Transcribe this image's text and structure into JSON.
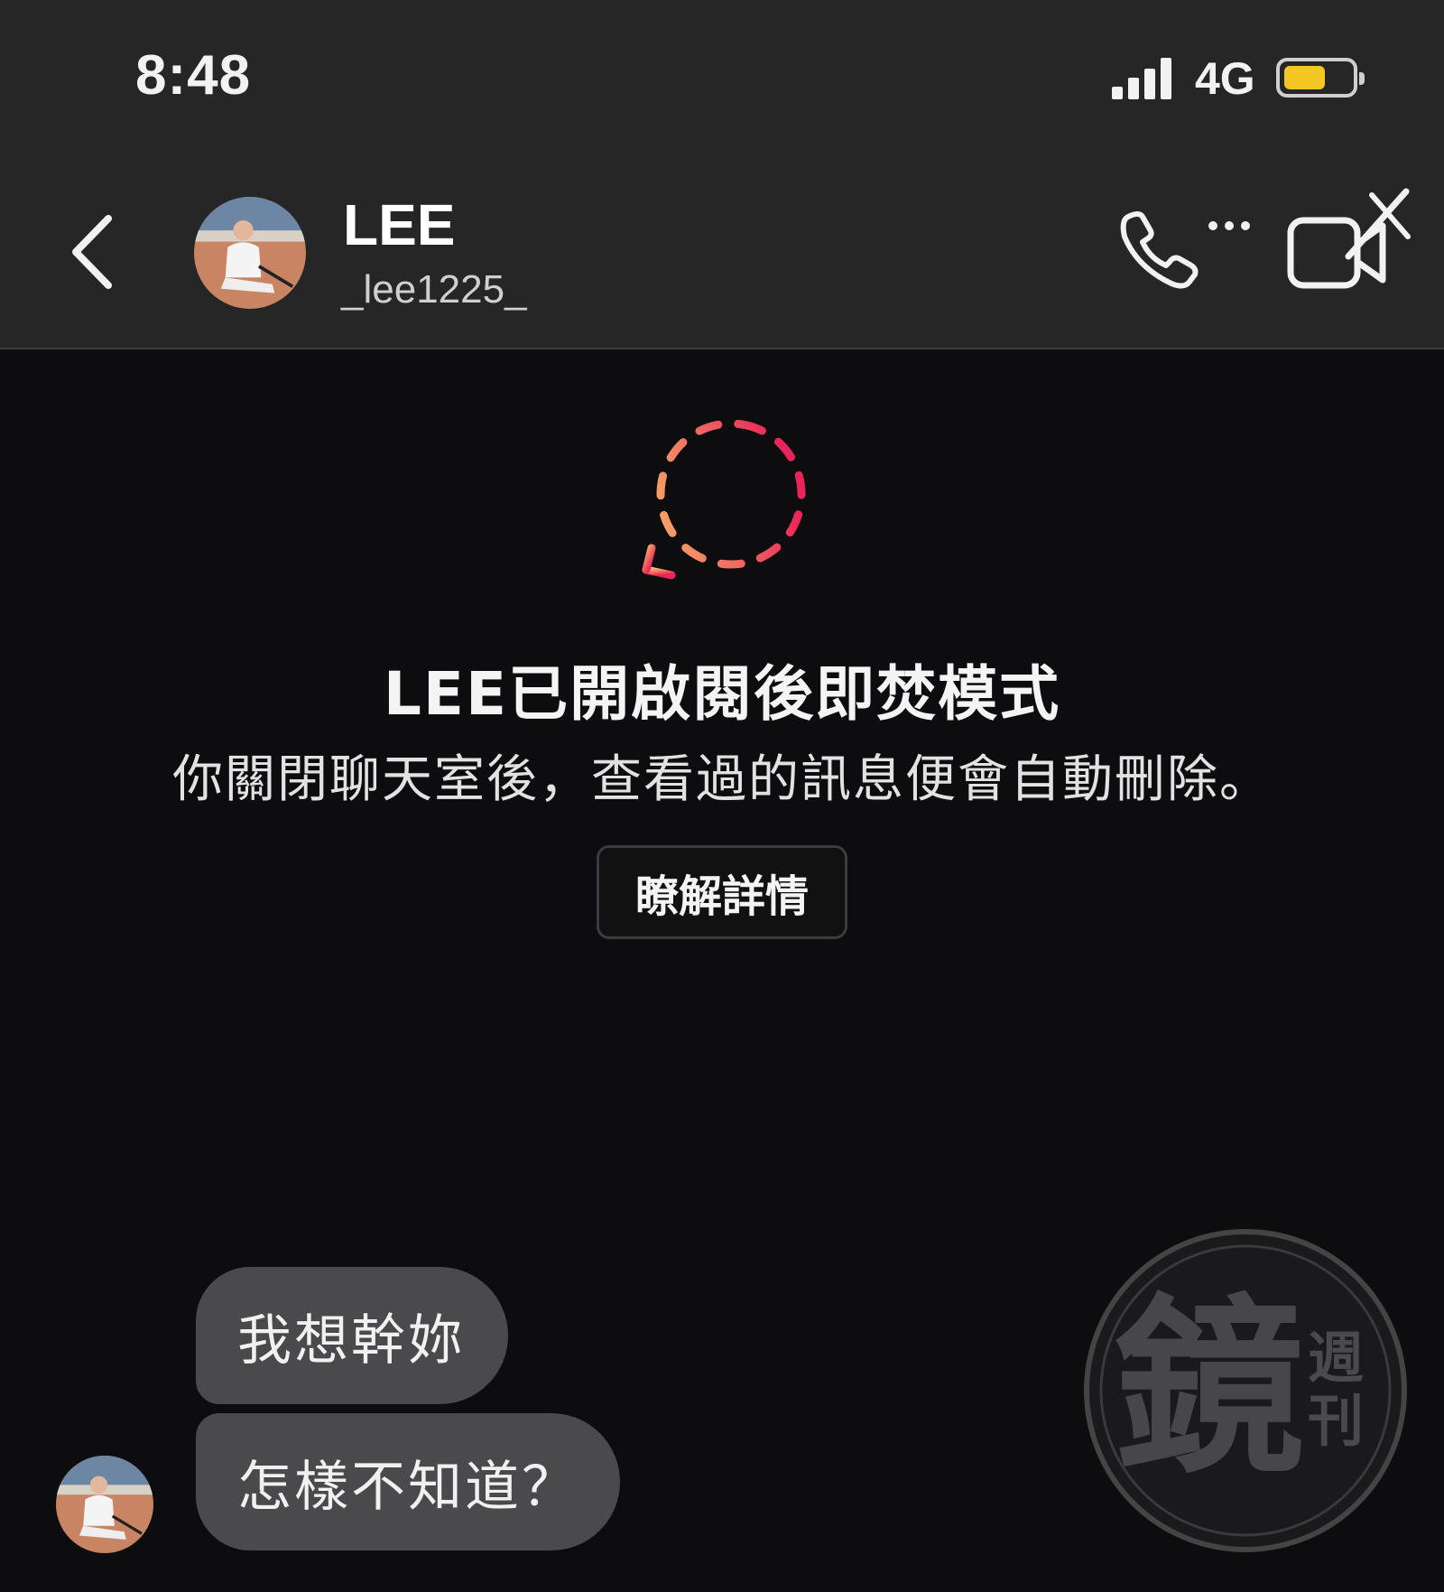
{
  "status_bar": {
    "time": "8:48",
    "network": "4G",
    "battery_level": 0.62,
    "icons": [
      "signal-icon",
      "battery-icon"
    ]
  },
  "header": {
    "contact_name": "LEE",
    "contact_handle": "_lee1225_",
    "icons": [
      "back-chevron-icon",
      "phone-icon",
      "video-camera-off-icon"
    ]
  },
  "vanish_mode": {
    "icon": "vanish-mode-dashed-bubble-icon",
    "title": "LEE已開啟閱後即焚模式",
    "description": "你關閉聊天室後，查看過的訊息便會自動刪除。",
    "learn_more_label": "瞭解詳情"
  },
  "messages": [
    {
      "sender": "LEE",
      "text": "我想幹妳"
    },
    {
      "sender": "LEE",
      "text": "怎樣不知道？"
    }
  ],
  "watermark": {
    "text": "鏡週刊"
  },
  "colors": {
    "background": "#0d0d0f",
    "header": "#262626",
    "bubble": "#4a4a4c",
    "vanish_gradient_start": "#f7b267",
    "vanish_gradient_end": "#e8245a",
    "battery": "#f3c623"
  }
}
